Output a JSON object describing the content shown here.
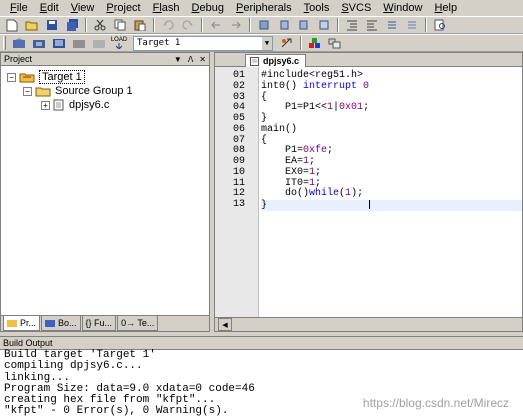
{
  "menu": [
    {
      "first": "F",
      "rest": "ile"
    },
    {
      "first": "E",
      "rest": "dit"
    },
    {
      "first": "V",
      "rest": "iew"
    },
    {
      "first": "P",
      "rest": "roject"
    },
    {
      "first": "Fl",
      "rest": "ash"
    },
    {
      "first": "D",
      "rest": "ebug"
    },
    {
      "first": "P",
      "rest": "eripherals"
    },
    {
      "first": "T",
      "rest": "ools"
    },
    {
      "first": "S",
      "rest": "VCS"
    },
    {
      "first": "W",
      "rest": "indow"
    },
    {
      "first": "H",
      "rest": "elp"
    }
  ],
  "toolbar2": {
    "target_value": "Target 1",
    "load_label": "LOAD"
  },
  "project": {
    "title": "Project",
    "target": "Target 1",
    "group": "Source Group 1",
    "file": "dpjsy6.c"
  },
  "project_tabs": [
    "Pr...",
    "Bo...",
    "{} Fu...",
    "0→ Te..."
  ],
  "editor": {
    "tab_label": "dpjsy6.c",
    "lines": [
      {
        "no": "01",
        "parts": [
          {
            "t": "#include<reg51.h>",
            "c": ""
          }
        ]
      },
      {
        "no": "02",
        "parts": [
          {
            "t": "int0() ",
            "c": ""
          },
          {
            "t": "interrupt",
            "c": "kw"
          },
          {
            "t": " ",
            "c": ""
          },
          {
            "t": "0",
            "c": "num"
          }
        ]
      },
      {
        "no": "03",
        "parts": [
          {
            "t": "{",
            "c": ""
          }
        ]
      },
      {
        "no": "04",
        "parts": [
          {
            "t": "    P1=P1<<",
            "c": ""
          },
          {
            "t": "1",
            "c": "num"
          },
          {
            "t": "|",
            "c": ""
          },
          {
            "t": "0x01",
            "c": "num"
          },
          {
            "t": ";",
            "c": ""
          }
        ]
      },
      {
        "no": "05",
        "parts": [
          {
            "t": "}",
            "c": ""
          }
        ]
      },
      {
        "no": "06",
        "parts": [
          {
            "t": "main()",
            "c": ""
          }
        ]
      },
      {
        "no": "07",
        "parts": [
          {
            "t": "{",
            "c": ""
          }
        ]
      },
      {
        "no": "08",
        "parts": [
          {
            "t": "    P1=",
            "c": ""
          },
          {
            "t": "0xfe",
            "c": "num"
          },
          {
            "t": ";",
            "c": ""
          }
        ]
      },
      {
        "no": "09",
        "parts": [
          {
            "t": "    EA=",
            "c": ""
          },
          {
            "t": "1",
            "c": "num"
          },
          {
            "t": ";",
            "c": ""
          }
        ]
      },
      {
        "no": "10",
        "parts": [
          {
            "t": "    EX0=",
            "c": ""
          },
          {
            "t": "1",
            "c": "num"
          },
          {
            "t": ";",
            "c": ""
          }
        ]
      },
      {
        "no": "11",
        "parts": [
          {
            "t": "    IT0=",
            "c": ""
          },
          {
            "t": "1",
            "c": "num"
          },
          {
            "t": ";",
            "c": ""
          }
        ]
      },
      {
        "no": "12",
        "parts": [
          {
            "t": "    do()",
            "c": ""
          },
          {
            "t": "while",
            "c": "kw"
          },
          {
            "t": "(",
            "c": ""
          },
          {
            "t": "1",
            "c": "num"
          },
          {
            "t": ");",
            "c": ""
          }
        ]
      },
      {
        "no": "13",
        "parts": [
          {
            "t": "}",
            "c": ""
          }
        ]
      }
    ],
    "current_line": 13
  },
  "build": {
    "title": "Build Output",
    "lines": [
      "Build target 'Target 1'",
      "compiling dpjsy6.c...",
      "linking...",
      "Program Size: data=9.0 xdata=0 code=46",
      "creating hex file from \"kfpt\"...",
      "\"kfpt\" - 0 Error(s), 0 Warning(s)."
    ]
  },
  "watermark": "https://blog.csdn.net/Mirecz",
  "colors": {
    "keyword": "#0000ff",
    "number": "#800080",
    "chrome": "#d4d0c8"
  }
}
